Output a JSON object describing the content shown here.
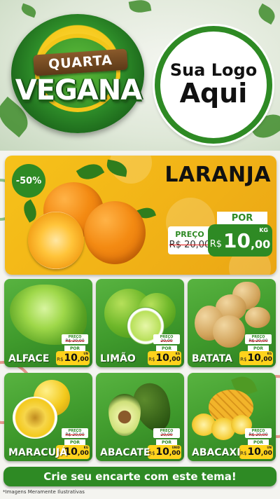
{
  "header": {
    "badge_line1": "QUARTA",
    "badge_line2": "VEGANA",
    "logo_line1": "Sua Logo",
    "logo_line2": "Aqui"
  },
  "featured": {
    "discount": "-50%",
    "name": "LARANJA",
    "preco_label": "PREÇO",
    "old_price": "R$ 20,00",
    "por_label": "POR",
    "currency": "R$",
    "price_int": "10",
    "price_dec": ",00",
    "unit": "KG"
  },
  "products": [
    {
      "name": "ALFACE",
      "preco_label": "PREÇO",
      "old_price": "R$ 20,00",
      "por_label": "POR",
      "currency": "R$",
      "price_int": "10",
      "price_dec": ",00",
      "unit": "UN"
    },
    {
      "name": "LIMÃO",
      "preco_label": "PREÇO",
      "old_price": "20,00",
      "por_label": "POR",
      "currency": "R$",
      "price_int": "10",
      "price_dec": ",00",
      "unit": "KG"
    },
    {
      "name": "BATATA",
      "preco_label": "PREÇO",
      "old_price": "R$ 20,00",
      "por_label": "POR",
      "currency": "R$",
      "price_int": "10",
      "price_dec": ",00",
      "unit": "KG"
    },
    {
      "name": "MARACUJÁ",
      "preco_label": "PREÇO",
      "old_price": "R$ 20,00",
      "por_label": "POR",
      "currency": "R$",
      "price_int": "10",
      "price_dec": ",00",
      "unit": "KG"
    },
    {
      "name": "ABACATE",
      "preco_label": "PREÇO",
      "old_price": "20,00",
      "por_label": "POR",
      "currency": "R$",
      "price_int": "10",
      "price_dec": ",00",
      "unit": "UNID"
    },
    {
      "name": "ABACAXI",
      "preco_label": "PREÇO",
      "old_price": "R$ 20,00",
      "por_label": "POR",
      "currency": "R$",
      "price_int": "10",
      "price_dec": ",00",
      "unit": "UN"
    }
  ],
  "cta": {
    "label": "Crie seu encarte com este tema!"
  },
  "disclaimer": "*Imagens Meramente Ilustrativas",
  "colors": {
    "brand_green": "#2e8a24",
    "accent_yellow": "#f6c21a",
    "price_yellow": "#ffd21c"
  }
}
